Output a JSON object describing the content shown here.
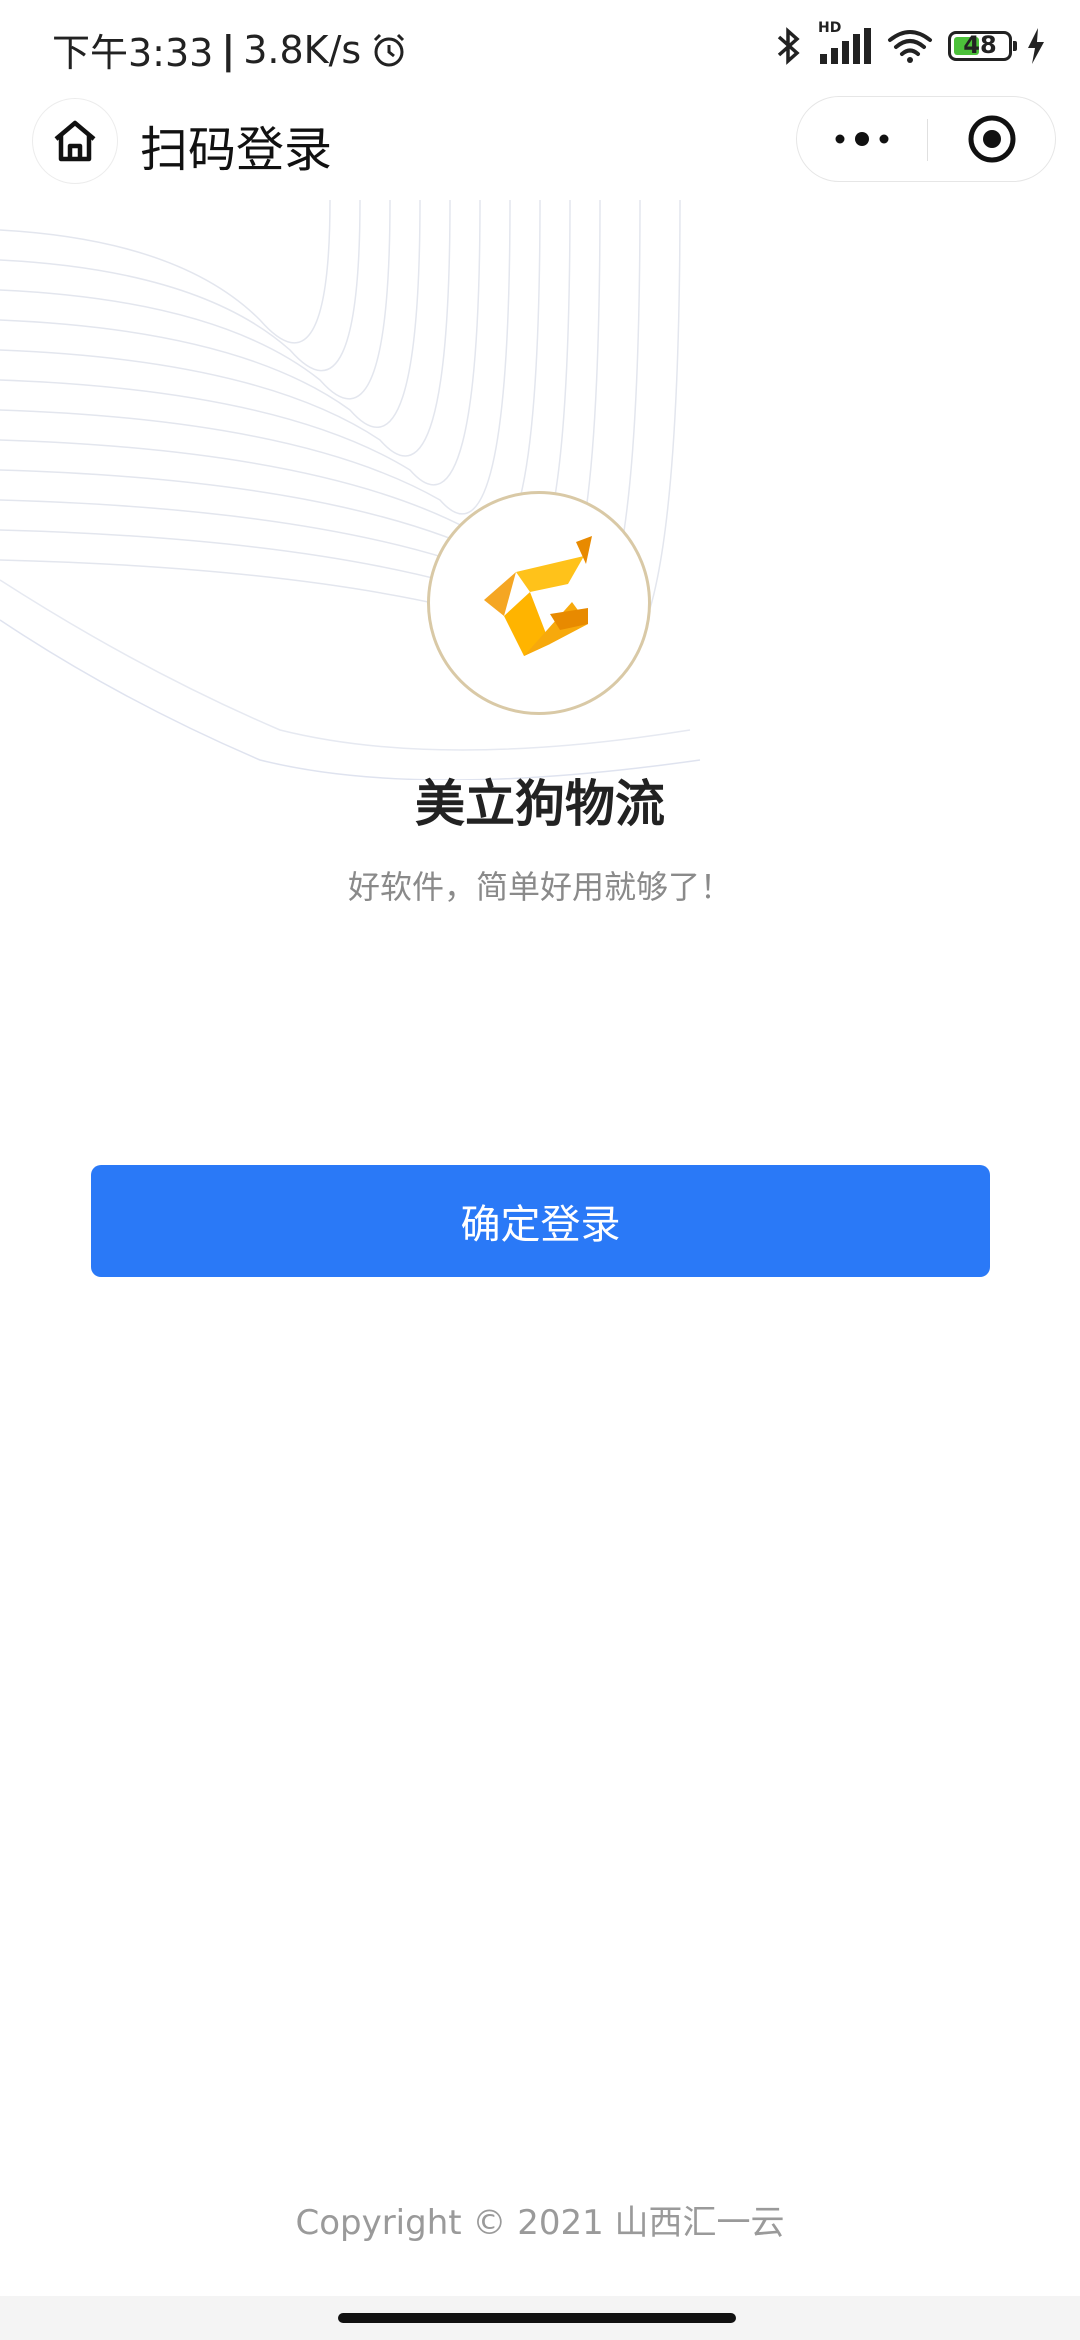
{
  "status_bar": {
    "time": "下午3:33",
    "net_speed": "3.8K/s",
    "hd_label": "HD",
    "battery_level": "48",
    "battery_fraction": 0.48
  },
  "nav": {
    "title": "扫码登录"
  },
  "brand": {
    "name": "美立狗物流",
    "slogan": "好软件，简单好用就够了！",
    "logo_colors": [
      "#f5a623",
      "#ffc21a",
      "#e88a00"
    ]
  },
  "actions": {
    "confirm_label": "确定登录",
    "confirm_color": "#2a79f7"
  },
  "footer": {
    "copyright": "Copyright © 2021 山西汇一云"
  }
}
